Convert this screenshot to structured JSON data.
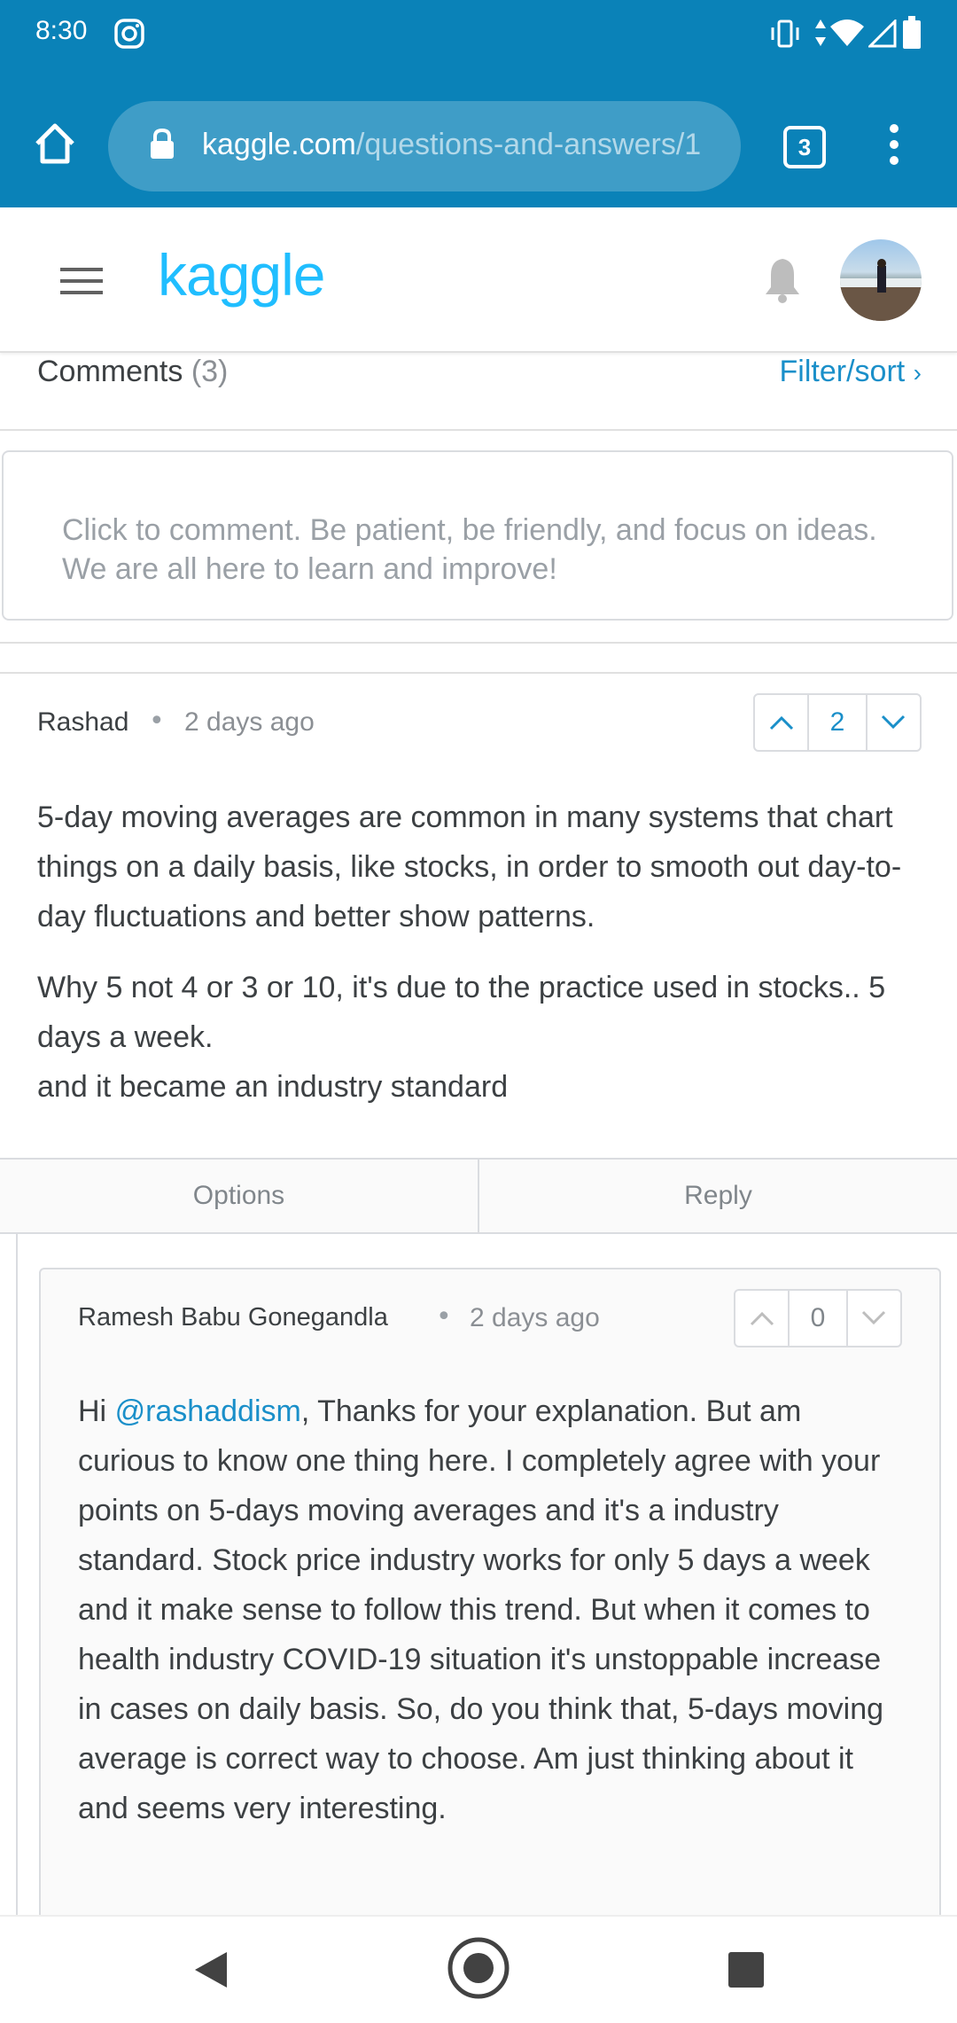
{
  "status_bar": {
    "time": "8:30",
    "icons": [
      "instagram-icon",
      "vibrate-icon",
      "data-arrows-icon",
      "wifi-icon",
      "cell-signal-icon",
      "battery-icon"
    ]
  },
  "browser": {
    "url_domain": "kaggle.com",
    "url_path": "/questions-and-answers/1",
    "tab_count": "3"
  },
  "header": {
    "logo_text": "kaggle",
    "brand_color": "#20beff"
  },
  "comments": {
    "title": "Comments",
    "count": "(3)",
    "filter_label": "Filter/sort",
    "placeholder": "Click to comment. Be patient, be friendly, and focus on ideas. We are all here to learn and improve!"
  },
  "comment1": {
    "author": "Rashad",
    "time": "2 days ago",
    "votes": "2",
    "paragraph1": "5-day moving averages are common in many systems that chart things on a daily basis, like stocks, in order to smooth out day-to-day fluctuations and better show patterns.",
    "paragraph2_line1": "Why 5 not 4 or 3 or 10, it's due to the practice used in stocks.. 5 days a week.",
    "paragraph2_line2": "and it became an industry standard",
    "options_label": "Options",
    "reply_label": "Reply"
  },
  "comment2": {
    "author": "Ramesh Babu Gonegandla",
    "time": "2 days ago",
    "votes": "0",
    "greeting": "Hi ",
    "mention": "@rashaddism",
    "body": ", Thanks for your explanation. But am curious to know one thing here. I completely agree with your points on 5-days moving averages and it's a industry standard. Stock price industry works for only 5 days a week and it make sense to follow this trend. But when it comes to health industry COVID-19 situation it's unstoppable increase in cases on daily basis. So, do you think that, 5-days moving average is correct way to choose. Am just thinking about it and seems very interesting."
  },
  "colors": {
    "browser_blue": "#0a82b8",
    "link_blue": "#1a8fc9"
  }
}
